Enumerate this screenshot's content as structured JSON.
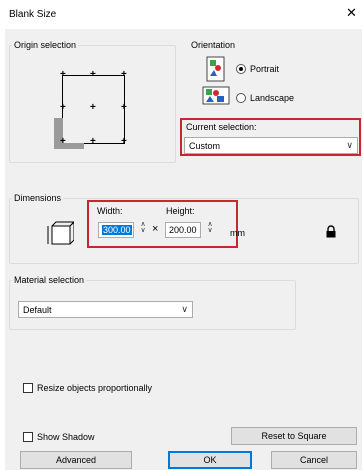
{
  "window": {
    "title": "Blank Size",
    "close_glyph": "✕"
  },
  "origin": {
    "legend": "Origin selection"
  },
  "orientation": {
    "legend": "Orientation",
    "portrait_label": "Portrait",
    "landscape_label": "Landscape",
    "selected": "Portrait"
  },
  "current_selection": {
    "label": "Current selection:",
    "value": "Custom"
  },
  "dimensions": {
    "legend": "Dimensions",
    "width_label": "Width:",
    "height_label": "Height:",
    "width_value": "300.00",
    "height_value": "200.00",
    "times": "×",
    "unit": "mm"
  },
  "material": {
    "legend": "Material selection",
    "value": "Default"
  },
  "options": {
    "resize_label": "Resize objects proportionally",
    "show_shadow_label": "Show Shadow"
  },
  "buttons": {
    "reset": "Reset to Square",
    "advanced": "Advanced",
    "ok": "OK",
    "cancel": "Cancel"
  },
  "colors": {
    "highlight_border": "#c8282d",
    "selection": "#0078d7"
  }
}
